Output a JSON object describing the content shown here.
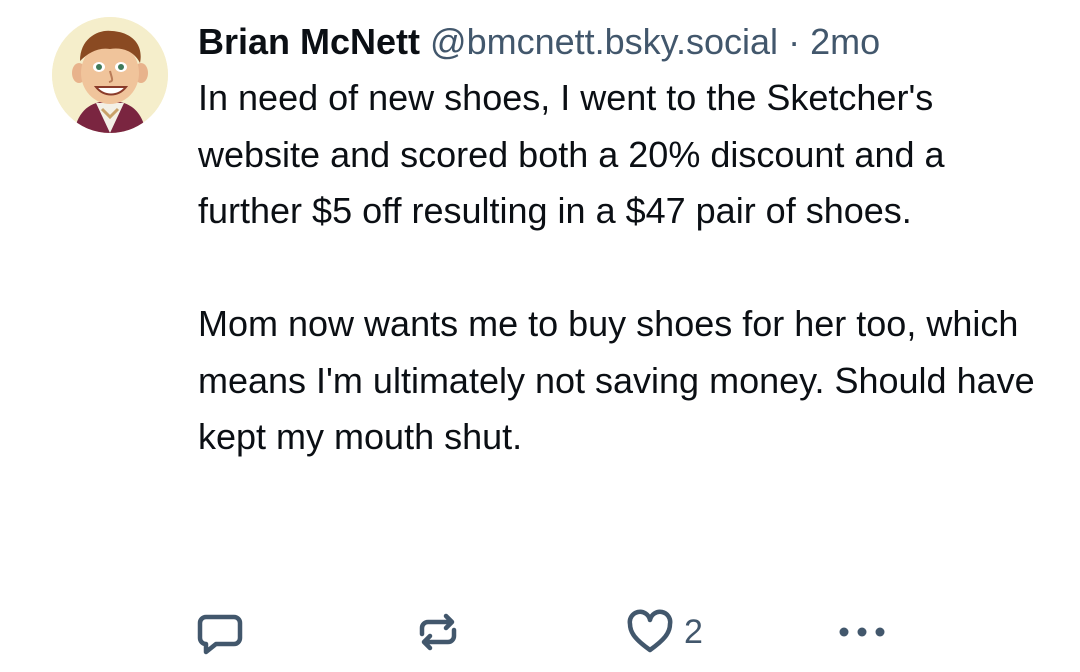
{
  "post": {
    "author_name": "Brian McNett",
    "handle": "@bmcnett.bsky.social",
    "separator": "·",
    "timestamp": "2mo",
    "text": {
      "paragraph1": "In need of new shoes, I went to the Sketcher's website and scored both a 20% discount and a further $5 off resulting in a $47 pair of shoes.",
      "paragraph2": "Mom now wants me to buy shoes for her too, which means I'm ultimately not saving money. Should have kept my mouth shut."
    },
    "actions": {
      "reply_icon": "speech-bubble-icon",
      "repost_icon": "repost-arrows-icon",
      "like_icon": "heart-outline-icon",
      "like_count": "2",
      "more_icon": "ellipsis-icon"
    }
  },
  "colors": {
    "text": "#0b0f14",
    "muted": "#42576c",
    "avatar_bg": "#f5eecb"
  }
}
